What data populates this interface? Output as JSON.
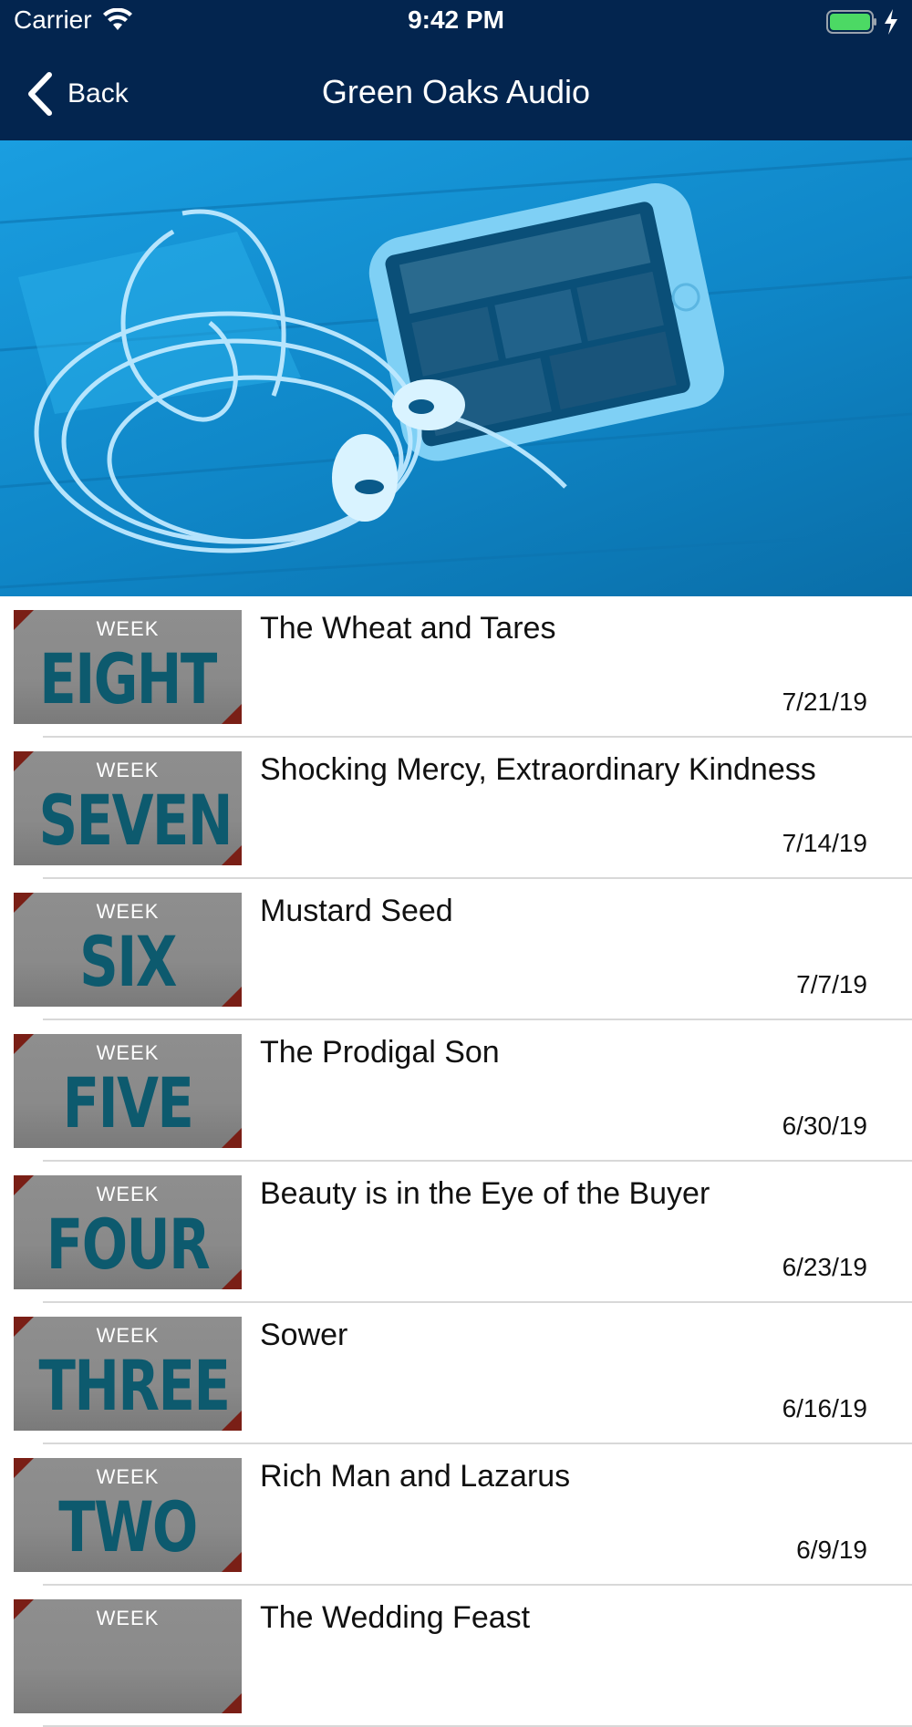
{
  "status_bar": {
    "carrier": "Carrier",
    "time": "9:42 PM",
    "battery_color": "#4cd964"
  },
  "nav": {
    "back_label": "Back",
    "title": "Green Oaks Audio"
  },
  "hero": {
    "tint_color": "#1a9ee0"
  },
  "episodes": [
    {
      "week_label": "WEEK",
      "week_number": "EIGHT",
      "title": "The Wheat and Tares",
      "date": "7/21/19"
    },
    {
      "week_label": "WEEK",
      "week_number": "SEVEN",
      "title": "Shocking Mercy, Extraordinary Kindness",
      "date": "7/14/19"
    },
    {
      "week_label": "WEEK",
      "week_number": "SIX",
      "title": "Mustard Seed",
      "date": "7/7/19"
    },
    {
      "week_label": "WEEK",
      "week_number": "FIVE",
      "title": "The Prodigal Son",
      "date": "6/30/19"
    },
    {
      "week_label": "WEEK",
      "week_number": "FOUR",
      "title": "Beauty is in the Eye of the Buyer",
      "date": "6/23/19"
    },
    {
      "week_label": "WEEK",
      "week_number": "THREE",
      "title": "Sower",
      "date": "6/16/19"
    },
    {
      "week_label": "WEEK",
      "week_number": "TWO",
      "title": "Rich Man and Lazarus",
      "date": "6/9/19"
    },
    {
      "week_label": "WEEK",
      "week_number": "",
      "title": "The Wedding Feast",
      "date": ""
    }
  ]
}
